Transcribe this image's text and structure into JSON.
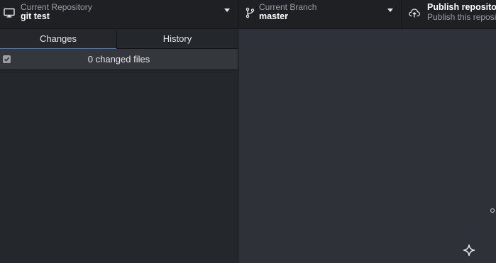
{
  "toolbar": {
    "repository": {
      "label": "Current Repository",
      "value": "git test",
      "icon": "desktop-icon"
    },
    "branch": {
      "label": "Current Branch",
      "value": "master",
      "icon": "git-branch-icon"
    },
    "publish": {
      "title": "Publish repository",
      "subtitle": "Publish this repository",
      "icon": "cloud-upload-icon"
    }
  },
  "sidebar": {
    "tabs": [
      {
        "label": "Changes",
        "selected": true
      },
      {
        "label": "History",
        "selected": false
      }
    ],
    "changes_summary": "0 changed files",
    "select_all_checked": true
  },
  "colors": {
    "accent": "#2f7ed8",
    "toolbar_bg": "#1e2024",
    "sidebar_bg": "#24272b",
    "main_bg": "#2e3137"
  }
}
